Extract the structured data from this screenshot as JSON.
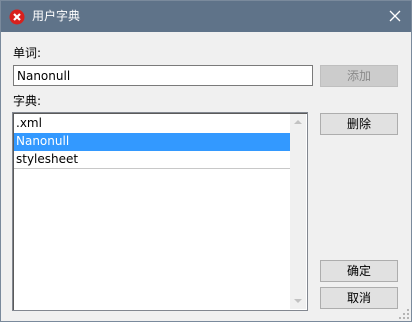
{
  "window": {
    "title": "用户字典",
    "icon": "app-close-x-icon",
    "accent": "#5f7389"
  },
  "word": {
    "label": "单词:",
    "value": "Nanonull",
    "add_label": "添加"
  },
  "dictionary": {
    "label": "字典:",
    "items": [
      ".xml",
      "Nanonull",
      "stylesheet"
    ],
    "selected": "Nanonull",
    "delete_label": "删除"
  },
  "footer": {
    "ok_label": "确定",
    "cancel_label": "取消"
  }
}
